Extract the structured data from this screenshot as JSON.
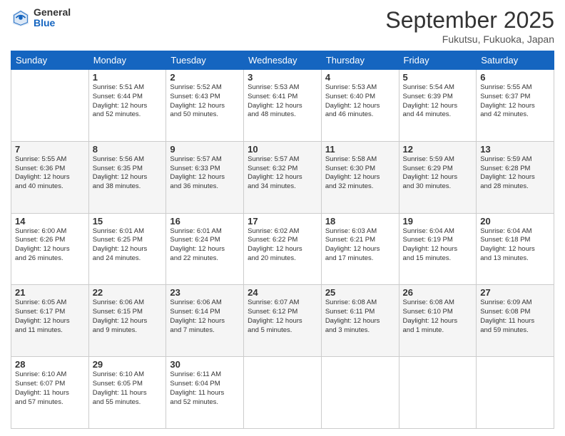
{
  "logo": {
    "general": "General",
    "blue": "Blue"
  },
  "header": {
    "title": "September 2025",
    "subtitle": "Fukutsu, Fukuoka, Japan"
  },
  "days_of_week": [
    "Sunday",
    "Monday",
    "Tuesday",
    "Wednesday",
    "Thursday",
    "Friday",
    "Saturday"
  ],
  "weeks": [
    {
      "bg": "white",
      "cells": [
        {
          "day": "",
          "info": ""
        },
        {
          "day": "1",
          "info": "Sunrise: 5:51 AM\nSunset: 6:44 PM\nDaylight: 12 hours\nand 52 minutes."
        },
        {
          "day": "2",
          "info": "Sunrise: 5:52 AM\nSunset: 6:43 PM\nDaylight: 12 hours\nand 50 minutes."
        },
        {
          "day": "3",
          "info": "Sunrise: 5:53 AM\nSunset: 6:41 PM\nDaylight: 12 hours\nand 48 minutes."
        },
        {
          "day": "4",
          "info": "Sunrise: 5:53 AM\nSunset: 6:40 PM\nDaylight: 12 hours\nand 46 minutes."
        },
        {
          "day": "5",
          "info": "Sunrise: 5:54 AM\nSunset: 6:39 PM\nDaylight: 12 hours\nand 44 minutes."
        },
        {
          "day": "6",
          "info": "Sunrise: 5:55 AM\nSunset: 6:37 PM\nDaylight: 12 hours\nand 42 minutes."
        }
      ]
    },
    {
      "bg": "gray",
      "cells": [
        {
          "day": "7",
          "info": "Sunrise: 5:55 AM\nSunset: 6:36 PM\nDaylight: 12 hours\nand 40 minutes."
        },
        {
          "day": "8",
          "info": "Sunrise: 5:56 AM\nSunset: 6:35 PM\nDaylight: 12 hours\nand 38 minutes."
        },
        {
          "day": "9",
          "info": "Sunrise: 5:57 AM\nSunset: 6:33 PM\nDaylight: 12 hours\nand 36 minutes."
        },
        {
          "day": "10",
          "info": "Sunrise: 5:57 AM\nSunset: 6:32 PM\nDaylight: 12 hours\nand 34 minutes."
        },
        {
          "day": "11",
          "info": "Sunrise: 5:58 AM\nSunset: 6:30 PM\nDaylight: 12 hours\nand 32 minutes."
        },
        {
          "day": "12",
          "info": "Sunrise: 5:59 AM\nSunset: 6:29 PM\nDaylight: 12 hours\nand 30 minutes."
        },
        {
          "day": "13",
          "info": "Sunrise: 5:59 AM\nSunset: 6:28 PM\nDaylight: 12 hours\nand 28 minutes."
        }
      ]
    },
    {
      "bg": "white",
      "cells": [
        {
          "day": "14",
          "info": "Sunrise: 6:00 AM\nSunset: 6:26 PM\nDaylight: 12 hours\nand 26 minutes."
        },
        {
          "day": "15",
          "info": "Sunrise: 6:01 AM\nSunset: 6:25 PM\nDaylight: 12 hours\nand 24 minutes."
        },
        {
          "day": "16",
          "info": "Sunrise: 6:01 AM\nSunset: 6:24 PM\nDaylight: 12 hours\nand 22 minutes."
        },
        {
          "day": "17",
          "info": "Sunrise: 6:02 AM\nSunset: 6:22 PM\nDaylight: 12 hours\nand 20 minutes."
        },
        {
          "day": "18",
          "info": "Sunrise: 6:03 AM\nSunset: 6:21 PM\nDaylight: 12 hours\nand 17 minutes."
        },
        {
          "day": "19",
          "info": "Sunrise: 6:04 AM\nSunset: 6:19 PM\nDaylight: 12 hours\nand 15 minutes."
        },
        {
          "day": "20",
          "info": "Sunrise: 6:04 AM\nSunset: 6:18 PM\nDaylight: 12 hours\nand 13 minutes."
        }
      ]
    },
    {
      "bg": "gray",
      "cells": [
        {
          "day": "21",
          "info": "Sunrise: 6:05 AM\nSunset: 6:17 PM\nDaylight: 12 hours\nand 11 minutes."
        },
        {
          "day": "22",
          "info": "Sunrise: 6:06 AM\nSunset: 6:15 PM\nDaylight: 12 hours\nand 9 minutes."
        },
        {
          "day": "23",
          "info": "Sunrise: 6:06 AM\nSunset: 6:14 PM\nDaylight: 12 hours\nand 7 minutes."
        },
        {
          "day": "24",
          "info": "Sunrise: 6:07 AM\nSunset: 6:12 PM\nDaylight: 12 hours\nand 5 minutes."
        },
        {
          "day": "25",
          "info": "Sunrise: 6:08 AM\nSunset: 6:11 PM\nDaylight: 12 hours\nand 3 minutes."
        },
        {
          "day": "26",
          "info": "Sunrise: 6:08 AM\nSunset: 6:10 PM\nDaylight: 12 hours\nand 1 minute."
        },
        {
          "day": "27",
          "info": "Sunrise: 6:09 AM\nSunset: 6:08 PM\nDaylight: 11 hours\nand 59 minutes."
        }
      ]
    },
    {
      "bg": "white",
      "cells": [
        {
          "day": "28",
          "info": "Sunrise: 6:10 AM\nSunset: 6:07 PM\nDaylight: 11 hours\nand 57 minutes."
        },
        {
          "day": "29",
          "info": "Sunrise: 6:10 AM\nSunset: 6:05 PM\nDaylight: 11 hours\nand 55 minutes."
        },
        {
          "day": "30",
          "info": "Sunrise: 6:11 AM\nSunset: 6:04 PM\nDaylight: 11 hours\nand 52 minutes."
        },
        {
          "day": "",
          "info": ""
        },
        {
          "day": "",
          "info": ""
        },
        {
          "day": "",
          "info": ""
        },
        {
          "day": "",
          "info": ""
        }
      ]
    }
  ]
}
